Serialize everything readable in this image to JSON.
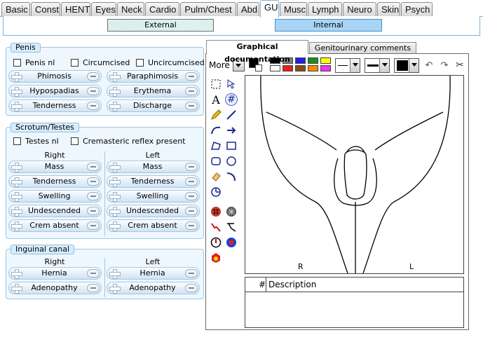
{
  "tabs": [
    {
      "label": "Basic"
    },
    {
      "label": "Const"
    },
    {
      "label": "HENT"
    },
    {
      "label": "Eyes"
    },
    {
      "label": "Neck"
    },
    {
      "label": "Cardio"
    },
    {
      "label": "Pulm/Chest"
    },
    {
      "label": "Abd"
    },
    {
      "label": "GU"
    },
    {
      "label": "Musc"
    },
    {
      "label": "Lymph"
    },
    {
      "label": "Neuro"
    },
    {
      "label": "Skin"
    },
    {
      "label": "Psych"
    }
  ],
  "subtabs": {
    "external": "External",
    "internal": "Internal"
  },
  "penis": {
    "title": "Penis",
    "checks": [
      "Penis nl",
      "Circumcised",
      "Uncircumcised"
    ],
    "rows": [
      [
        "Phimosis",
        "Paraphimosis"
      ],
      [
        "Hypospadias",
        "Erythema"
      ],
      [
        "Tenderness",
        "Discharge"
      ]
    ]
  },
  "scrotum": {
    "title": "Scrotum/Testes",
    "checks": [
      "Testes nl",
      "Cremasteric reflex present"
    ],
    "right": "Right",
    "left": "Left",
    "items": [
      "Mass",
      "Tenderness",
      "Swelling",
      "Undescended",
      "Crem absent"
    ]
  },
  "inguinal": {
    "title": "Inguinal canal",
    "right": "Right",
    "left": "Left",
    "items": [
      "Hernia",
      "Adenopathy"
    ]
  },
  "graphical": {
    "tab_active": "Graphical documentation",
    "tab_other": "Genitourinary comments",
    "more": "More",
    "palette": [
      "#000000",
      "#808080",
      "#1f1fe8",
      "#1a8f1a",
      "#ffff00",
      "#ffffff",
      "#e81f1f",
      "#8a4a10",
      "#ff8800",
      "#ee33ee"
    ],
    "canvas_left_label": "R",
    "canvas_right_label": "L",
    "desc_num": "#",
    "desc_title": "Description"
  },
  "colors": {
    "accent": "#7fb3d5",
    "panel_bg": "#eef7fe"
  }
}
